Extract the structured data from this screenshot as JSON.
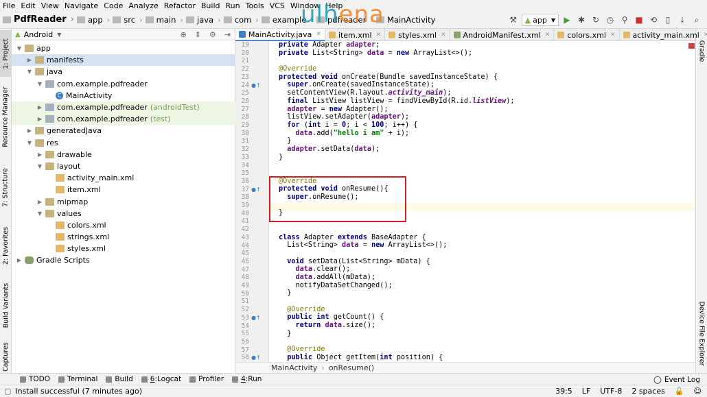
{
  "menu": [
    "File",
    "Edit",
    "View",
    "Navigate",
    "Code",
    "Analyze",
    "Refactor",
    "Build",
    "Run",
    "Tools",
    "VCS",
    "Window",
    "Help"
  ],
  "breadcrumb": [
    "PdfReader",
    "app",
    "src",
    "main",
    "java",
    "com",
    "example",
    "pdfreader",
    "MainActivity"
  ],
  "watermark": {
    "part1": "ulh",
    "part2": "ena"
  },
  "run_config": "app",
  "left_strip": {
    "project": "1: Project",
    "resource_manager": "Resource Manager",
    "structure": "7: Structure",
    "favorites": "2: Favorites",
    "build_variants": "Build Variants",
    "captures": "Captures"
  },
  "right_strip": {
    "gradle": "Gradle",
    "device_file_explorer": "Device File Explorer"
  },
  "project": {
    "view": "Android",
    "tree": [
      {
        "label": "app",
        "suffix": "",
        "depth": 0,
        "icon": "folder",
        "arrow": "down",
        "state": ""
      },
      {
        "label": "manifests",
        "suffix": "",
        "depth": 1,
        "icon": "folder",
        "arrow": "right",
        "state": "selected"
      },
      {
        "label": "java",
        "suffix": "",
        "depth": 1,
        "icon": "folder",
        "arrow": "down",
        "state": ""
      },
      {
        "label": "com.example.pdfreader",
        "suffix": "",
        "depth": 2,
        "icon": "pkg",
        "arrow": "down",
        "state": ""
      },
      {
        "label": "MainActivity",
        "suffix": "",
        "depth": 3,
        "icon": "cls",
        "arrow": "",
        "state": ""
      },
      {
        "label": "com.example.pdfreader",
        "suffix": "(androidTest)",
        "depth": 2,
        "icon": "pkg",
        "arrow": "right",
        "state": "green"
      },
      {
        "label": "com.example.pdfreader",
        "suffix": "(test)",
        "depth": 2,
        "icon": "pkg",
        "arrow": "right",
        "state": "green"
      },
      {
        "label": "generatedJava",
        "suffix": "",
        "depth": 1,
        "icon": "folder",
        "arrow": "right",
        "state": ""
      },
      {
        "label": "res",
        "suffix": "",
        "depth": 1,
        "icon": "res",
        "arrow": "down",
        "state": ""
      },
      {
        "label": "drawable",
        "suffix": "",
        "depth": 2,
        "icon": "folder",
        "arrow": "right",
        "state": ""
      },
      {
        "label": "layout",
        "suffix": "",
        "depth": 2,
        "icon": "folder",
        "arrow": "down",
        "state": ""
      },
      {
        "label": "activity_main.xml",
        "suffix": "",
        "depth": 3,
        "icon": "xml",
        "arrow": "",
        "state": ""
      },
      {
        "label": "item.xml",
        "suffix": "",
        "depth": 3,
        "icon": "xml",
        "arrow": "",
        "state": ""
      },
      {
        "label": "mipmap",
        "suffix": "",
        "depth": 2,
        "icon": "folder",
        "arrow": "right",
        "state": ""
      },
      {
        "label": "values",
        "suffix": "",
        "depth": 2,
        "icon": "folder",
        "arrow": "down",
        "state": ""
      },
      {
        "label": "colors.xml",
        "suffix": "",
        "depth": 3,
        "icon": "xml",
        "arrow": "",
        "state": ""
      },
      {
        "label": "strings.xml",
        "suffix": "",
        "depth": 3,
        "icon": "xml",
        "arrow": "",
        "state": ""
      },
      {
        "label": "styles.xml",
        "suffix": "",
        "depth": 3,
        "icon": "xml",
        "arrow": "",
        "state": ""
      },
      {
        "label": "Gradle Scripts",
        "suffix": "",
        "depth": 0,
        "icon": "gradle",
        "arrow": "right",
        "state": ""
      }
    ]
  },
  "tabs": [
    {
      "label": "MainActivity.java",
      "active": true,
      "color": "#3d7fc7"
    },
    {
      "label": "item.xml",
      "active": false,
      "color": "#e4b869"
    },
    {
      "label": "styles.xml",
      "active": false,
      "color": "#e4b869"
    },
    {
      "label": "AndroidManifest.xml",
      "active": false,
      "color": "#8aa06d"
    },
    {
      "label": "colors.xml",
      "active": false,
      "color": "#e4b869"
    },
    {
      "label": "activity_main.xml",
      "active": false,
      "color": "#e4b869"
    }
  ],
  "editor": {
    "lines": [
      {
        "n": "19",
        "t": [
          [
            "kw",
            "private "
          ],
          [
            "",
            "Adapter "
          ],
          [
            "fd",
            "adapter"
          ],
          [
            "",
            ";"
          ]
        ]
      },
      {
        "n": "20",
        "t": [
          [
            "kw",
            "private "
          ],
          [
            "",
            "List<String> "
          ],
          [
            "fd",
            "data"
          ],
          [
            "",
            " = "
          ],
          [
            "kw",
            "new "
          ],
          [
            "",
            "ArrayList<>();"
          ]
        ]
      },
      {
        "n": "21",
        "t": []
      },
      {
        "n": "22",
        "t": [
          [
            "an",
            "@Override"
          ]
        ]
      },
      {
        "n": "23",
        "t": [
          [
            "kw",
            "protected void "
          ],
          [
            "",
            "onCreate(Bundle savedInstanceState) {"
          ]
        ]
      },
      {
        "n": "24",
        "g": "ov",
        "t": [
          [
            "kw",
            "  super"
          ],
          [
            "",
            ".onCreate(savedInstanceState);"
          ]
        ]
      },
      {
        "n": "25",
        "t": [
          [
            "",
            "  setContentView(R.layout."
          ],
          [
            "it",
            "activity_main"
          ],
          [
            "",
            ");"
          ]
        ]
      },
      {
        "n": "26",
        "t": [
          [
            "kw",
            "  final "
          ],
          [
            "",
            "ListView listView = findViewById(R.id."
          ],
          [
            "it",
            "listView"
          ],
          [
            "",
            ");"
          ]
        ]
      },
      {
        "n": "27",
        "t": [
          [
            "fd",
            "  adapter"
          ],
          [
            "",
            " = "
          ],
          [
            "kw",
            "new "
          ],
          [
            "",
            "Adapter();"
          ]
        ]
      },
      {
        "n": "28",
        "t": [
          [
            "",
            "  listView.setAdapter("
          ],
          [
            "fd",
            "adapter"
          ],
          [
            "",
            ");"
          ]
        ]
      },
      {
        "n": "29",
        "t": [
          [
            "kw",
            "  for "
          ],
          [
            "",
            "("
          ],
          [
            "kw",
            "int "
          ],
          [
            "",
            "i = "
          ],
          [
            "kw",
            "0"
          ],
          [
            "",
            "; i < "
          ],
          [
            "kw",
            "100"
          ],
          [
            "",
            "; i++) {"
          ]
        ]
      },
      {
        "n": "30",
        "t": [
          [
            "fd",
            "    data"
          ],
          [
            "",
            ".add("
          ],
          [
            "st",
            "\"hello i am\""
          ],
          [
            "",
            " + i);"
          ]
        ]
      },
      {
        "n": "31",
        "t": [
          [
            "",
            "  }"
          ]
        ]
      },
      {
        "n": "32",
        "t": [
          [
            "fd",
            "  adapter"
          ],
          [
            "",
            ".setData("
          ],
          [
            "fd",
            "data"
          ],
          [
            "",
            ");"
          ]
        ]
      },
      {
        "n": "33",
        "t": [
          [
            "",
            "}"
          ]
        ]
      },
      {
        "n": "34",
        "t": []
      },
      {
        "n": "35",
        "t": []
      },
      {
        "n": "36",
        "t": [
          [
            "an",
            "@Override"
          ]
        ]
      },
      {
        "n": "37",
        "g": "ov",
        "t": [
          [
            "kw",
            "protected void "
          ],
          [
            "",
            "onResume(){"
          ]
        ]
      },
      {
        "n": "38",
        "t": [
          [
            "kw",
            "  super"
          ],
          [
            "",
            ".onResume();"
          ]
        ]
      },
      {
        "n": "39",
        "t": []
      },
      {
        "n": "40",
        "t": [
          [
            "",
            "}"
          ]
        ]
      },
      {
        "n": "41",
        "t": []
      },
      {
        "n": "42",
        "t": []
      },
      {
        "n": "43",
        "t": [
          [
            "kw",
            "class "
          ],
          [
            "",
            "Adapter "
          ],
          [
            "kw",
            "extends "
          ],
          [
            "",
            "BaseAdapter {"
          ]
        ]
      },
      {
        "n": "44",
        "t": [
          [
            "",
            "  List<String> "
          ],
          [
            "fd",
            "data"
          ],
          [
            "",
            " = "
          ],
          [
            "kw",
            "new "
          ],
          [
            "",
            "ArrayList<>();"
          ]
        ]
      },
      {
        "n": "45",
        "t": []
      },
      {
        "n": "46",
        "t": [
          [
            "kw",
            "  void "
          ],
          [
            "",
            "setData(List<String> mData) {"
          ]
        ]
      },
      {
        "n": "47",
        "t": [
          [
            "fd",
            "    data"
          ],
          [
            "",
            ".clear();"
          ]
        ]
      },
      {
        "n": "48",
        "t": [
          [
            "fd",
            "    data"
          ],
          [
            "",
            ".addAll(mData);"
          ]
        ]
      },
      {
        "n": "49",
        "t": [
          [
            "",
            "    notifyDataSetChanged();"
          ]
        ]
      },
      {
        "n": "50",
        "t": [
          [
            "",
            "  }"
          ]
        ]
      },
      {
        "n": "51",
        "t": []
      },
      {
        "n": "52",
        "t": [
          [
            "an",
            "  @Override"
          ]
        ]
      },
      {
        "n": "53",
        "g": "ov",
        "t": [
          [
            "kw",
            "  public int "
          ],
          [
            "",
            "getCount() {"
          ]
        ]
      },
      {
        "n": "54",
        "t": [
          [
            "kw",
            "    return "
          ],
          [
            "fd",
            "data"
          ],
          [
            "",
            ".size();"
          ]
        ]
      },
      {
        "n": "55",
        "t": [
          [
            "",
            "  }"
          ]
        ]
      },
      {
        "n": "56",
        "t": []
      },
      {
        "n": "57",
        "t": [
          [
            "an",
            "  @Override"
          ]
        ]
      },
      {
        "n": "58",
        "g": "ov",
        "t": [
          [
            "kw",
            "  public "
          ],
          [
            "",
            "Object getItem("
          ],
          [
            "kw",
            "int "
          ],
          [
            "",
            "position) {"
          ]
        ]
      }
    ]
  },
  "editor_breadcrumb": [
    "MainActivity",
    "onResume()"
  ],
  "tool_windows": [
    {
      "label": "TODO",
      "key": ""
    },
    {
      "label": "Terminal",
      "key": ""
    },
    {
      "label": "Build",
      "key": ""
    },
    {
      "label": "Logcat",
      "key": "6"
    },
    {
      "label": "Profiler",
      "key": ""
    },
    {
      "label": "Run",
      "key": "4"
    }
  ],
  "event_log": "Event Log",
  "status": {
    "message": "Install successful (7 minutes ago)",
    "position": "39:5",
    "line_sep": "LF",
    "encoding": "UTF-8",
    "indent": "2 spaces"
  }
}
